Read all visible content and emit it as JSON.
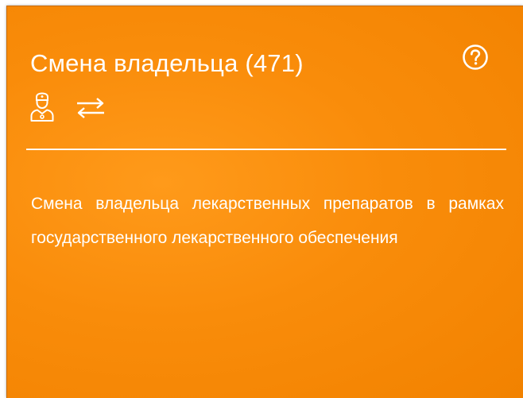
{
  "card": {
    "title": "Смена владельца (471)",
    "help_icon": "question-circle-icon",
    "icons": [
      "pharmacist-icon",
      "exchange-arrows-icon"
    ],
    "description": "Смена владельца лекарственных препаратов в рамках государственного лекарственного обеспечения",
    "colors": {
      "background": "#f98c0a",
      "text": "#ffffff"
    }
  }
}
